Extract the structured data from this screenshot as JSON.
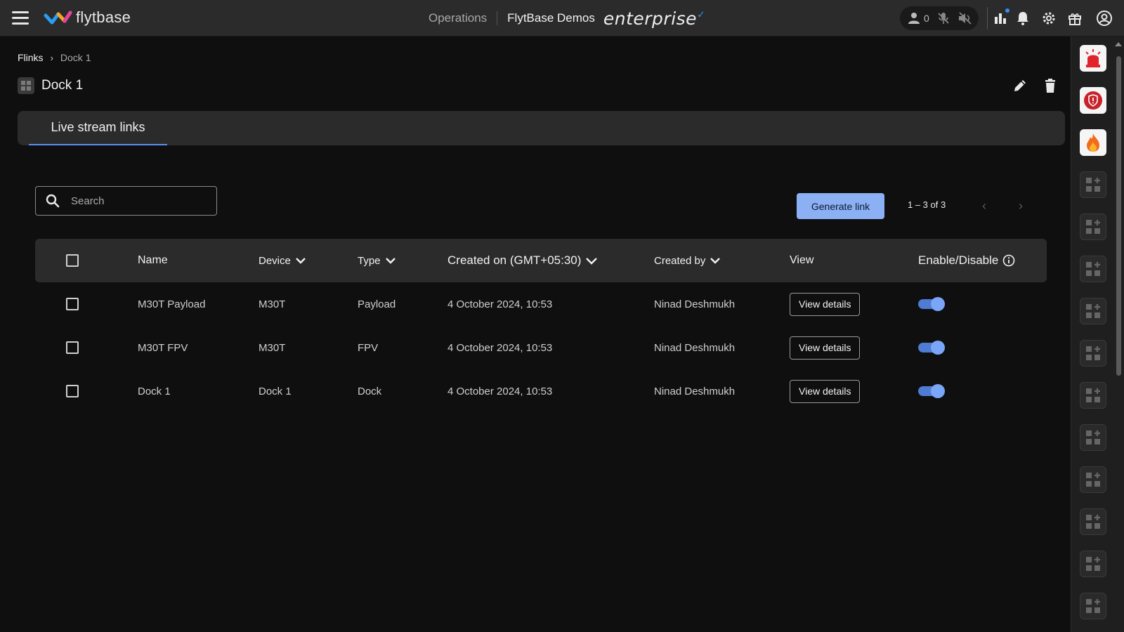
{
  "topbar": {
    "brand": "flytbase",
    "operations_label": "Operations",
    "org_name": "FlytBase Demos",
    "edition": "enterprise",
    "user_count": "0",
    "icons": [
      "user-icon",
      "mic-muted-icon",
      "speaker-muted-icon",
      "analytics-icon",
      "bell-icon",
      "settings-icon",
      "gift-icon",
      "account-icon"
    ]
  },
  "breadcrumb": {
    "parent": "Flinks",
    "current": "Dock 1"
  },
  "page": {
    "title": "Dock 1"
  },
  "tabs": [
    {
      "label": "Live stream links",
      "active": true
    }
  ],
  "search": {
    "placeholder": "Search",
    "value": ""
  },
  "actions": {
    "generate_label": "Generate link"
  },
  "pagination": {
    "range": "1 – 3 of 3"
  },
  "table": {
    "columns": {
      "name": "Name",
      "device": "Device",
      "type": "Type",
      "created_on": "Created on (GMT+05:30)",
      "created_by": "Created by",
      "view": "View",
      "enable": "Enable/Disable"
    },
    "rows": [
      {
        "name": "M30T Payload",
        "device": "M30T",
        "type": "Payload",
        "created_on": "4 October 2024, 10:53",
        "created_by": "Ninad Deshmukh",
        "view_label": "View details",
        "enabled": true
      },
      {
        "name": "M30T FPV",
        "device": "M30T",
        "type": "FPV",
        "created_on": "4 October 2024, 10:53",
        "created_by": "Ninad Deshmukh",
        "view_label": "View details",
        "enabled": true
      },
      {
        "name": "Dock 1",
        "device": "Dock 1",
        "type": "Dock",
        "created_on": "4 October 2024, 10:53",
        "created_by": "Ninad Deshmukh",
        "view_label": "View details",
        "enabled": true
      }
    ]
  },
  "colors": {
    "accent": "#5b8ef5",
    "primary_button": "#8bb1f4",
    "background": "#0f0f0f",
    "panel": "#2b2b2b"
  },
  "rightbar": {
    "items": [
      "alarm-siren-icon",
      "shield-alert-icon",
      "fire-icon",
      "widget-add-icon",
      "widget-add-icon",
      "widget-add-icon",
      "widget-add-icon",
      "widget-add-icon",
      "widget-add-icon",
      "widget-add-icon",
      "widget-add-icon",
      "widget-add-icon",
      "widget-add-icon",
      "widget-add-icon"
    ]
  }
}
